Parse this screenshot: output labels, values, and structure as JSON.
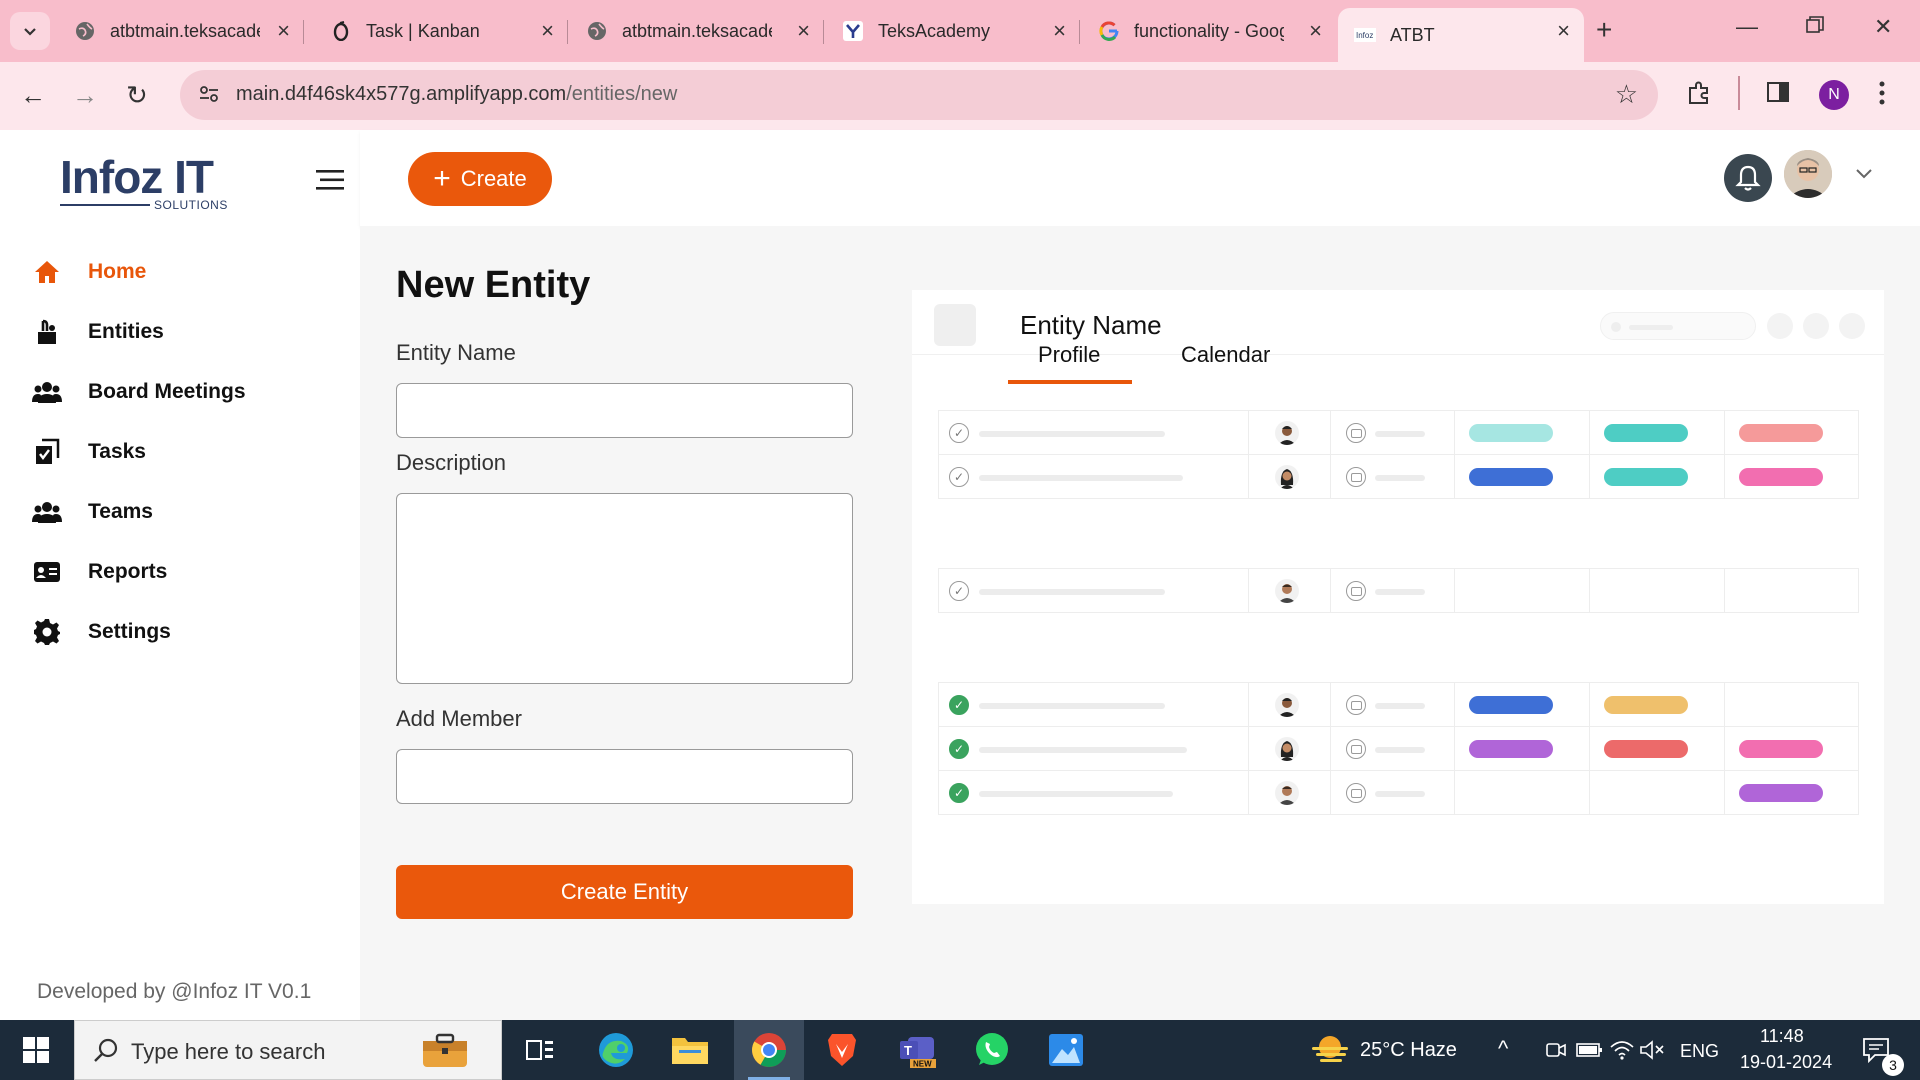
{
  "browser": {
    "tabs": [
      {
        "label": "atbtmain.teksacademy",
        "icon": "globe-icon",
        "active": false
      },
      {
        "label": "Task | Kanban",
        "icon": "opera-icon",
        "active": false
      },
      {
        "label": "atbtmain.teksacademy",
        "icon": "globe-icon",
        "active": false
      },
      {
        "label": "TeksAcademy",
        "icon": "teks-icon",
        "active": false
      },
      {
        "label": "functionality - Google",
        "icon": "google-icon",
        "active": false
      },
      {
        "label": "ATBT",
        "icon": "infoz-icon",
        "active": true
      }
    ],
    "url_main": "main.d4f46sk4x577g.amplifyapp.com",
    "url_path": "/entities/new",
    "profile_initial": "N"
  },
  "app": {
    "logo_text": "Infoz IT",
    "logo_sub": "SOLUTIONS",
    "create_label": "Create",
    "sidebar": {
      "items": [
        {
          "label": "Home",
          "icon": "home-icon",
          "active": true
        },
        {
          "label": "Entities",
          "icon": "entities-icon",
          "active": false
        },
        {
          "label": "Board Meetings",
          "icon": "users-group-icon",
          "active": false
        },
        {
          "label": "Tasks",
          "icon": "tasks-icon",
          "active": false
        },
        {
          "label": "Teams",
          "icon": "users-group-icon",
          "active": false
        },
        {
          "label": "Reports",
          "icon": "id-card-icon",
          "active": false
        },
        {
          "label": "Settings",
          "icon": "gear-icon",
          "active": false
        }
      ],
      "footer": "Developed by @Infoz IT V0.1"
    },
    "form": {
      "title": "New Entity",
      "entity_name_label": "Entity Name",
      "entity_name_value": "",
      "description_label": "Description",
      "description_value": "",
      "add_member_label": "Add Member",
      "add_member_value": "",
      "submit_label": "Create Entity"
    },
    "preview": {
      "title": "Entity Name",
      "tabs": [
        "Profile",
        "Calendar"
      ],
      "active_tab": "Profile",
      "colors": {
        "accent": "#ea580c",
        "teal_light": "#a6e6e2",
        "teal": "#4ecdc4",
        "salmon": "#f59a9a",
        "blue": "#3e6fd6",
        "pink": "#f26eb0",
        "amber": "#efc06c",
        "purple": "#b065d8",
        "red": "#ec6a6a",
        "green": "#3aa35e"
      }
    }
  },
  "taskbar": {
    "search_placeholder": "Type here to search",
    "weather": "25°C  Haze",
    "lang": "ENG",
    "time": "11:48",
    "date": "19-01-2024",
    "notif_count": "3"
  }
}
